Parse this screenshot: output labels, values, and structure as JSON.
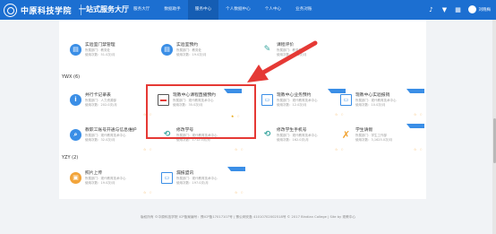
{
  "header": {
    "logo_text": "中原科技学院",
    "site_title": "一站式服务大厅",
    "nav": [
      "服务大厅",
      "数据助手",
      "服务中心",
      "个人数据中心",
      "个人中心",
      "业务对账"
    ],
    "user_name": "刘晓梅"
  },
  "sections": {
    "s2": "YWX (6)",
    "s3": "YZY (2)"
  },
  "cards": [
    {
      "name": "实验室门禁管理",
      "dept": "所属部门：教务处",
      "uses": "使用次数：51.0次/月"
    },
    {
      "name": "实验室预约",
      "dept": "所属部门：教务处",
      "uses": "使用次数：19.0次/月"
    },
    {
      "name": "课程评价",
      "dept": "所属部门：教务处",
      "uses": "使用次数：51.0次/月"
    },
    {
      "name": "学生活动报名",
      "dept": "所属部门：学生工作部",
      "uses": "使用次数：202.0次/月"
    },
    {
      "name": "并行卡记录表",
      "dept": "所属部门：人力资源部",
      "uses": "使用次数：202.0次/月"
    },
    {
      "name": "现教中心课程直播预约",
      "dept": "所属部门：现代教育技术中心",
      "uses": "使用次数：35.0次/月"
    },
    {
      "name": "现教中心业务预约",
      "dept": "所属部门：现代教育技术中心",
      "uses": "使用次数：12.0次/月"
    },
    {
      "name": "现教中心实验报销",
      "dept": "所属部门：现代教育技术中心",
      "uses": "使用次数：10.0次/月"
    },
    {
      "name": "教职工账号开通与信息维护",
      "dept": "所属部门：现代教育技术中心",
      "uses": "使用次数：32.0次/月"
    },
    {
      "name": "修改学号",
      "dept": "所属部门：现代教育技术中心",
      "uses": "使用次数：1712.0次/月"
    },
    {
      "name": "修改学生手机号",
      "dept": "所属部门：现代教育技术中心",
      "uses": "使用次数：162.0次/月"
    },
    {
      "name": "学生请假",
      "dept": "所属部门：学生工作部",
      "uses": "使用次数：3,1625.0次/月"
    },
    {
      "name": "照片上传",
      "dept": "所属部门：现代教育技术中心",
      "uses": "使用次数：19.0次/月"
    },
    {
      "name": "漏报盟讯",
      "dept": "所属部门：现代教育技术中心",
      "uses": "使用次数：197.0次/月"
    }
  ],
  "footer": "版权所有 ©中原科技学院 ICP备案编号：豫ICP备17017107号 | 豫公网安备 41010702002518号 © 2017 Bindian College | Site by 现教中心"
}
